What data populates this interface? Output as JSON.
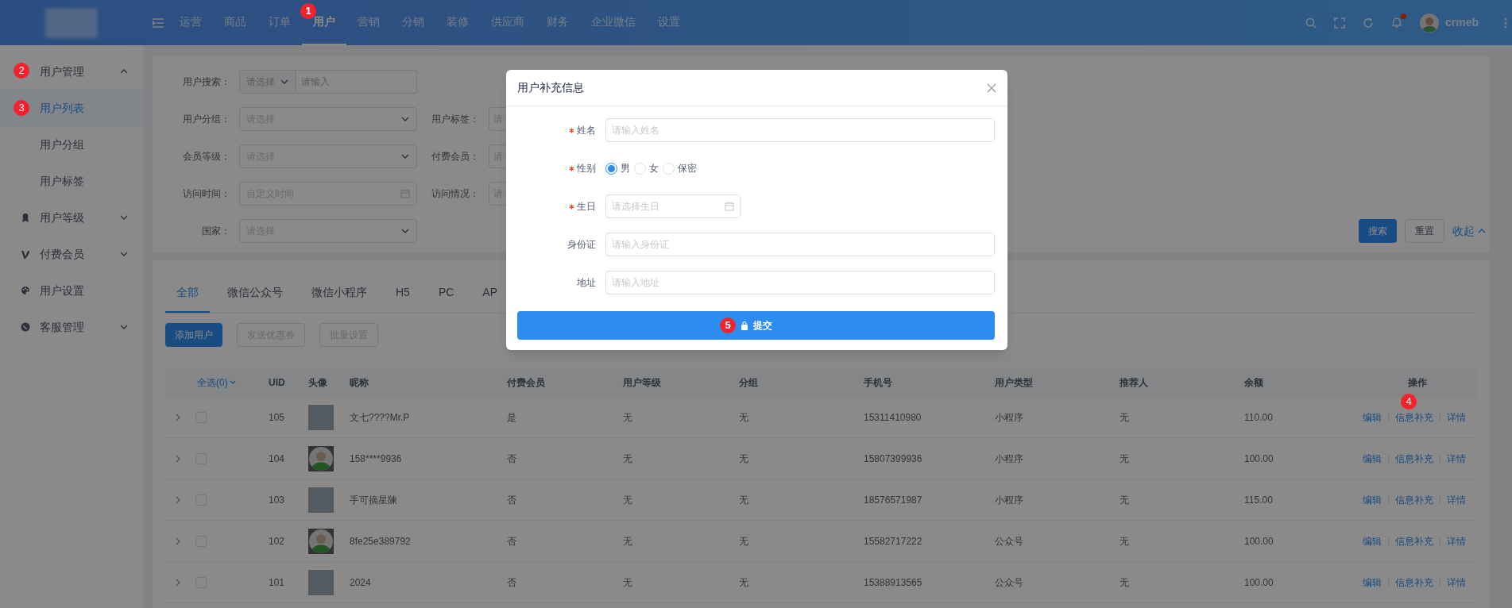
{
  "header": {
    "nav": [
      {
        "label": "运营",
        "selected": false
      },
      {
        "label": "商品",
        "selected": false
      },
      {
        "label": "订单",
        "selected": false
      },
      {
        "label": "用户",
        "selected": true,
        "marker": "1"
      },
      {
        "label": "营销",
        "selected": false
      },
      {
        "label": "分销",
        "selected": false
      },
      {
        "label": "装修",
        "selected": false
      },
      {
        "label": "供应商",
        "selected": false
      },
      {
        "label": "财务",
        "selected": false
      },
      {
        "label": "企业微信",
        "selected": false
      },
      {
        "label": "设置",
        "selected": false
      }
    ],
    "notification_dot": true,
    "user": "crmeb"
  },
  "sidebar": {
    "items": [
      {
        "label": "用户管理",
        "expanded": true,
        "marker": "2",
        "children": [
          {
            "label": "用户列表",
            "selected": true,
            "marker": "3"
          },
          {
            "label": "用户分组",
            "selected": false
          },
          {
            "label": "用户标签",
            "selected": false
          }
        ]
      },
      {
        "label": "用户等级",
        "expanded": false
      },
      {
        "label": "付费会员",
        "expanded": false
      },
      {
        "label": "用户设置"
      },
      {
        "label": "客服管理",
        "expanded": false
      }
    ]
  },
  "filters": {
    "rows": [
      [
        {
          "kind": "combo",
          "label": "用户搜索：",
          "select_placeholder": "请选择",
          "placeholder": "请输入"
        }
      ],
      [
        {
          "kind": "select",
          "label": "用户分组：",
          "placeholder": "请选择"
        },
        {
          "kind": "cut",
          "label": "用户标签：",
          "placeholder": "请"
        }
      ],
      [
        {
          "kind": "select",
          "label": "会员等级：",
          "placeholder": "请选择"
        },
        {
          "kind": "cut",
          "label": "付费会员：",
          "placeholder": "请"
        }
      ],
      [
        {
          "kind": "date",
          "label": "访问时间：",
          "placeholder": "自定义时间"
        },
        {
          "kind": "cut",
          "label": "访问情况：",
          "placeholder": "请"
        }
      ],
      [
        {
          "kind": "select",
          "label": "国家：",
          "placeholder": "请选择"
        }
      ]
    ],
    "actions": [
      {
        "label": "搜索",
        "kind": "primary"
      },
      {
        "label": "重置",
        "kind": "default"
      },
      {
        "label": "收起",
        "kind": "link"
      }
    ]
  },
  "tabs": [
    {
      "label": "全部",
      "selected": true
    },
    {
      "label": "微信公众号",
      "selected": false
    },
    {
      "label": "微信小程序",
      "selected": false
    },
    {
      "label": "H5",
      "selected": false
    },
    {
      "label": "PC",
      "selected": false
    },
    {
      "label": "AP",
      "selected": false
    }
  ],
  "toolbar": [
    {
      "label": "添加用户",
      "disabled": false
    },
    {
      "label": "发送优惠券",
      "disabled": true
    },
    {
      "label": "批量设置",
      "disabled": true
    }
  ],
  "table": {
    "select_all": "全选(0)",
    "columns": [
      "UID",
      "头像",
      "昵称",
      "付费会员",
      "用户等级",
      "分组",
      "手机号",
      "用户类型",
      "推荐人",
      "余额",
      "操作"
    ],
    "rows": [
      {
        "checked": false,
        "uid": "105",
        "kind": "photo",
        "nickname": "文七????Mr.P",
        "paid": "是",
        "level": "无",
        "group": "无",
        "phone": "15311410980",
        "type": "小程序",
        "referrer": "无",
        "balance": "110.00",
        "actions": [
          "编辑",
          "信息补充",
          "详情"
        ],
        "marker": "4"
      },
      {
        "checked": false,
        "uid": "104",
        "kind": "default",
        "nickname": "158****9936",
        "paid": "否",
        "level": "无",
        "group": "无",
        "phone": "15807399936",
        "type": "小程序",
        "referrer": "无",
        "balance": "100.00",
        "actions": [
          "编辑",
          "信息补充",
          "详情"
        ]
      },
      {
        "checked": false,
        "uid": "103",
        "kind": "photo",
        "nickname": "手可摘星陳",
        "paid": "否",
        "level": "无",
        "group": "无",
        "phone": "18576571987",
        "type": "小程序",
        "referrer": "无",
        "balance": "115.00",
        "actions": [
          "编辑",
          "信息补充",
          "详情"
        ]
      },
      {
        "checked": false,
        "uid": "102",
        "kind": "default",
        "nickname": "8fe25e389792",
        "paid": "否",
        "level": "无",
        "group": "无",
        "phone": "15582717222",
        "type": "公众号",
        "referrer": "无",
        "balance": "100.00",
        "actions": [
          "编辑",
          "信息补充",
          "详情"
        ]
      },
      {
        "checked": false,
        "uid": "101",
        "kind": "photo",
        "nickname": "2024",
        "paid": "否",
        "level": "无",
        "group": "无",
        "phone": "15388913565",
        "type": "公众号",
        "referrer": "无",
        "balance": "100.00",
        "actions": [
          "编辑",
          "信息补充",
          "详情"
        ]
      }
    ]
  },
  "modal": {
    "title": "用户补充信息",
    "fields": [
      {
        "kind": "text",
        "label": "姓名",
        "required": true,
        "placeholder": "请输入姓名"
      },
      {
        "kind": "radio",
        "label": "性别",
        "required": true,
        "options": [
          {
            "label": "男",
            "selected": true
          },
          {
            "label": "女",
            "selected": false
          },
          {
            "label": "保密",
            "selected": false
          }
        ]
      },
      {
        "kind": "date",
        "label": "生日",
        "required": true,
        "placeholder": "请选择生日"
      },
      {
        "kind": "text",
        "label": "身份证",
        "required": false,
        "placeholder": "请输入身份证"
      },
      {
        "kind": "text",
        "label": "地址",
        "required": false,
        "placeholder": "请输入地址"
      }
    ],
    "submit": {
      "label": "提交",
      "marker": "5"
    }
  }
}
